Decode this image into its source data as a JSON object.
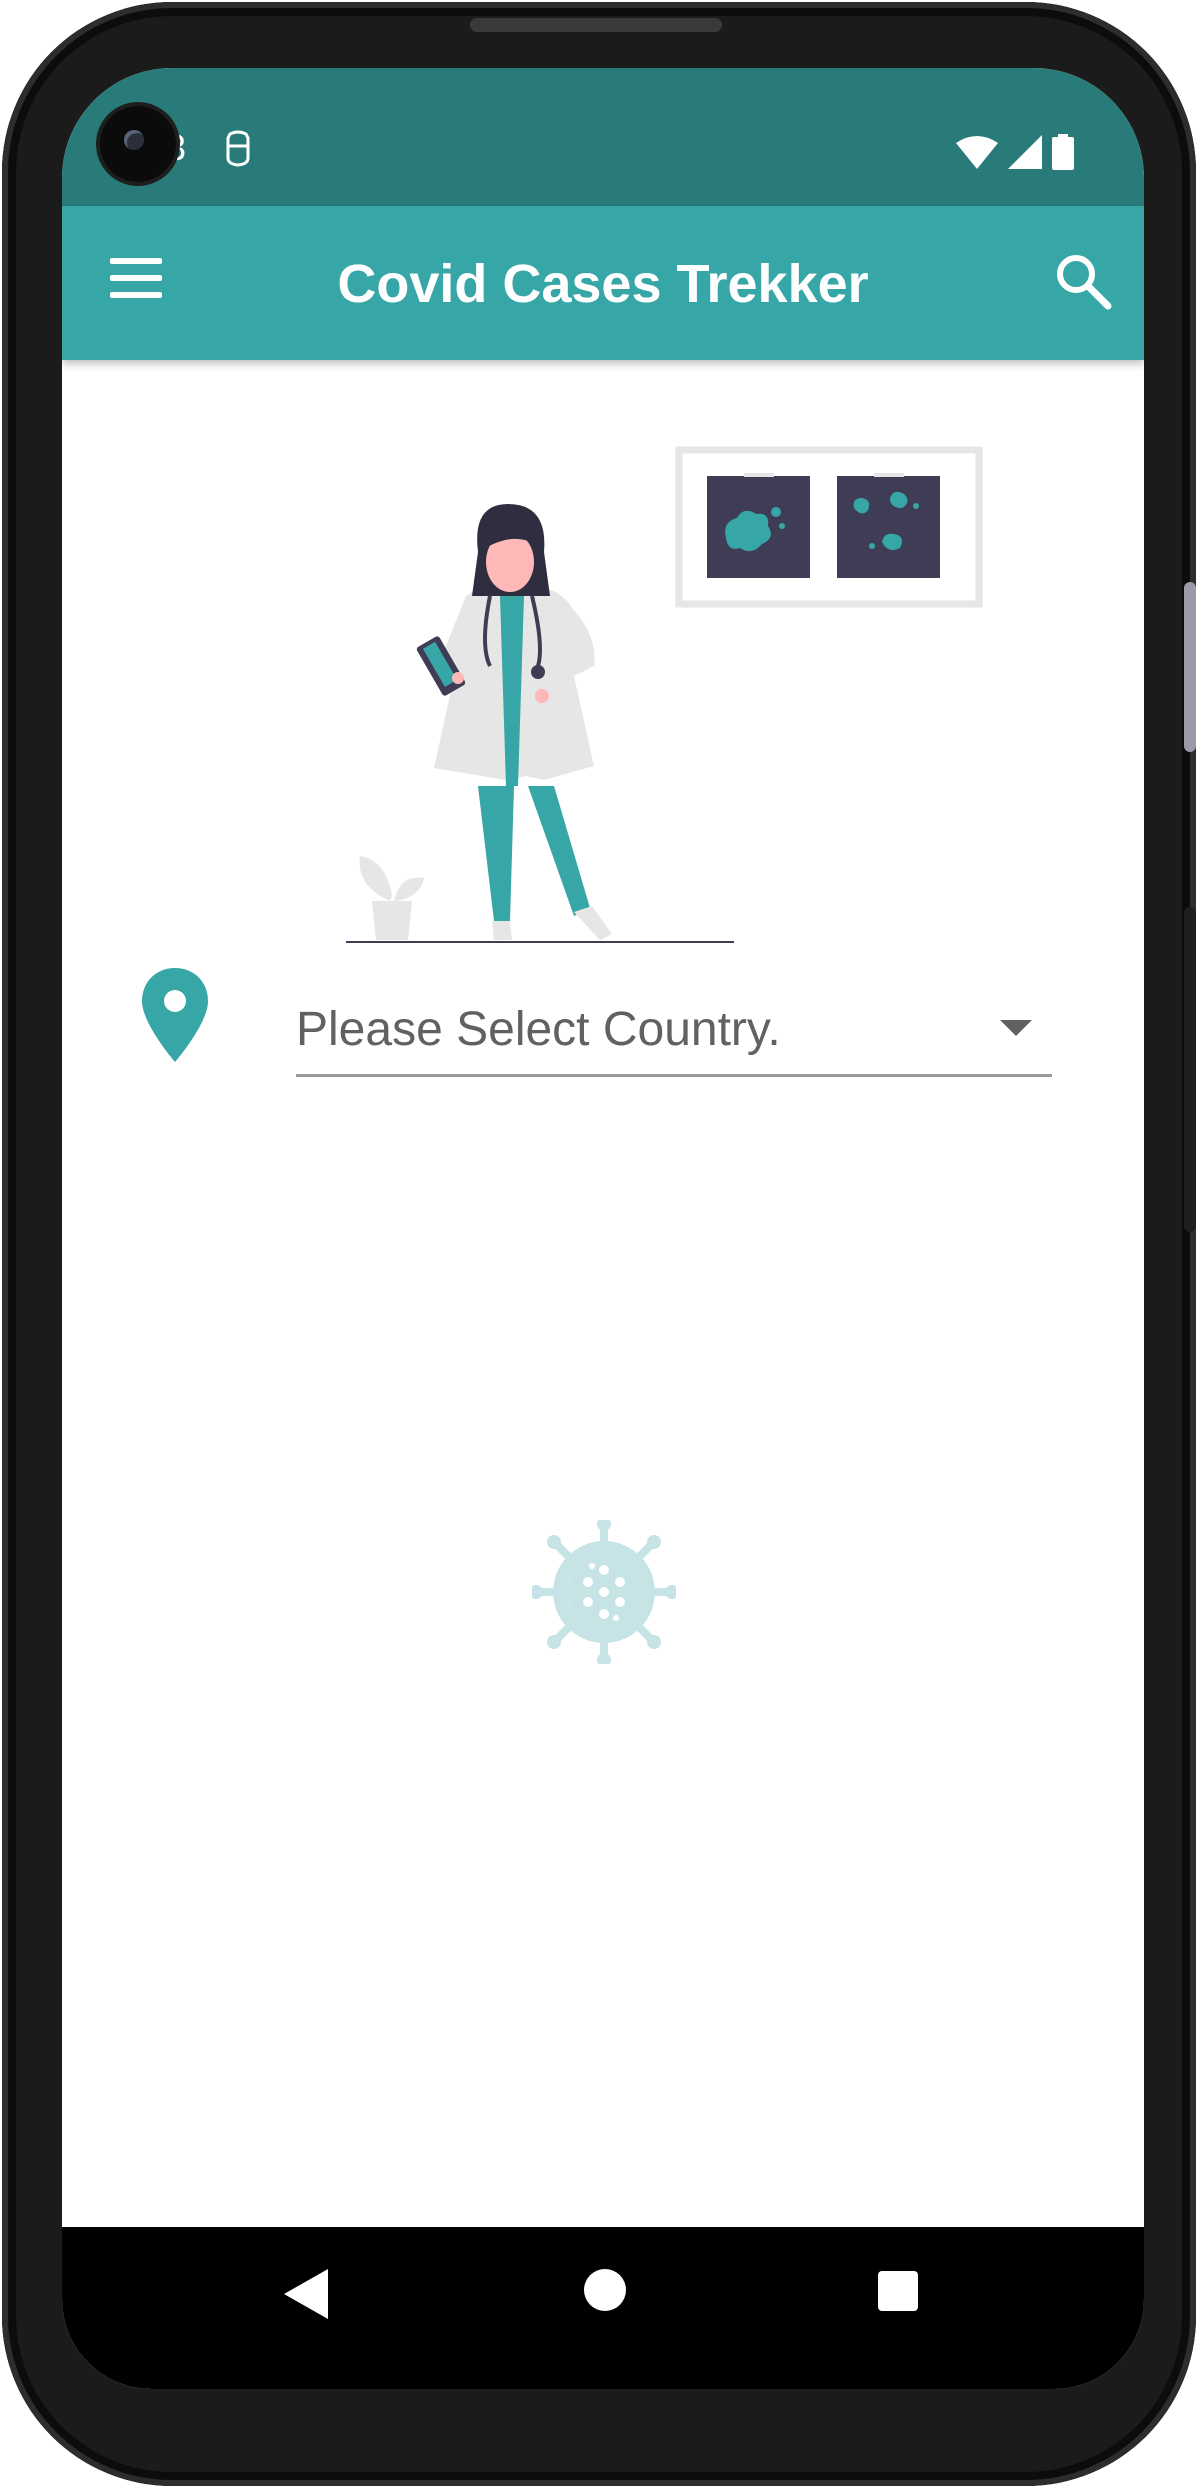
{
  "status_bar": {
    "time": "3",
    "background": "#287b79"
  },
  "app_bar": {
    "title": "Covid Cases Trekker",
    "menu_icon": "hamburger-menu-icon",
    "search_icon": "search-icon",
    "background": "#37a6a6"
  },
  "main": {
    "location_icon": "location-pin-icon",
    "country_select": {
      "selected_text": "Please Select Country.",
      "arrow_icon": "dropdown-arrow-icon"
    },
    "loading_icon": "virus-icon",
    "accent_color": "#37a6a6"
  },
  "nav_bar": {
    "back_icon": "back-icon",
    "home_icon": "home-icon",
    "recents_icon": "recents-icon"
  }
}
